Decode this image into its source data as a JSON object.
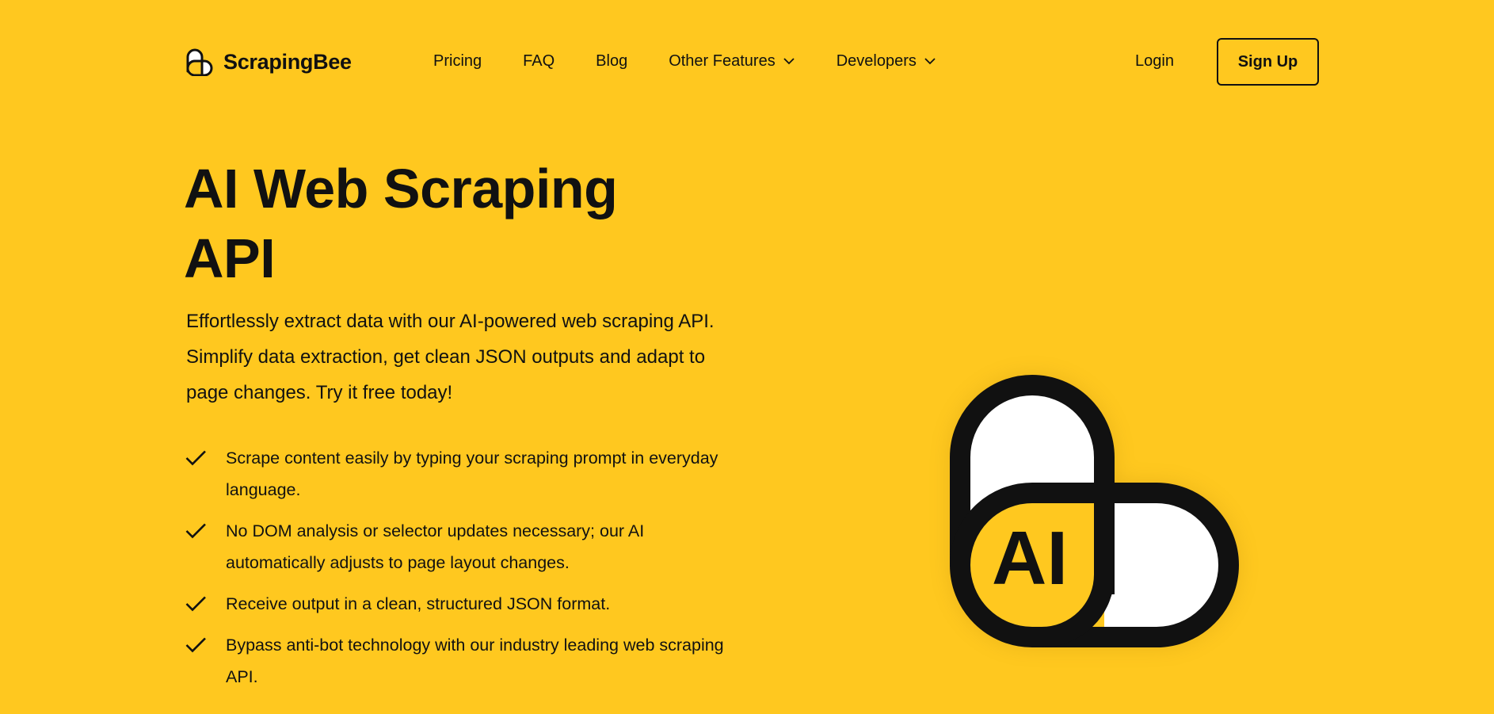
{
  "brand": {
    "name": "ScrapingBee",
    "colors": {
      "background": "#FFC81F",
      "ink": "#111111",
      "white": "#FFFFFF"
    }
  },
  "header": {
    "nav": [
      {
        "label": "Pricing",
        "has_dropdown": false
      },
      {
        "label": "FAQ",
        "has_dropdown": false
      },
      {
        "label": "Blog",
        "has_dropdown": false
      },
      {
        "label": "Other Features",
        "has_dropdown": true,
        "icon": "chevron-down-icon"
      },
      {
        "label": "Developers",
        "has_dropdown": true,
        "icon": "chevron-down-icon"
      }
    ],
    "login_label": "Login",
    "signup_label": "Sign Up"
  },
  "hero": {
    "title_line1": "AI Web Scraping",
    "title_line2": "API",
    "description": "Effortlessly extract data with our AI-powered web scraping API. Simplify data extraction, get clean JSON outputs and adapt to page changes. Try it free today!",
    "features": [
      {
        "icon": "check-icon",
        "text": "Scrape content easily by typing your scraping prompt in everyday language."
      },
      {
        "icon": "check-icon",
        "text": "No DOM analysis or selector updates necessary; our AI automatically adjusts to page layout changes."
      },
      {
        "icon": "check-icon",
        "text": "Receive output in a clean, structured JSON format."
      },
      {
        "icon": "check-icon",
        "text": "Bypass anti-bot technology with our industry leading web scraping API."
      }
    ],
    "illustration": {
      "icon": "ai-bee-logo-icon",
      "label": "AI"
    }
  }
}
